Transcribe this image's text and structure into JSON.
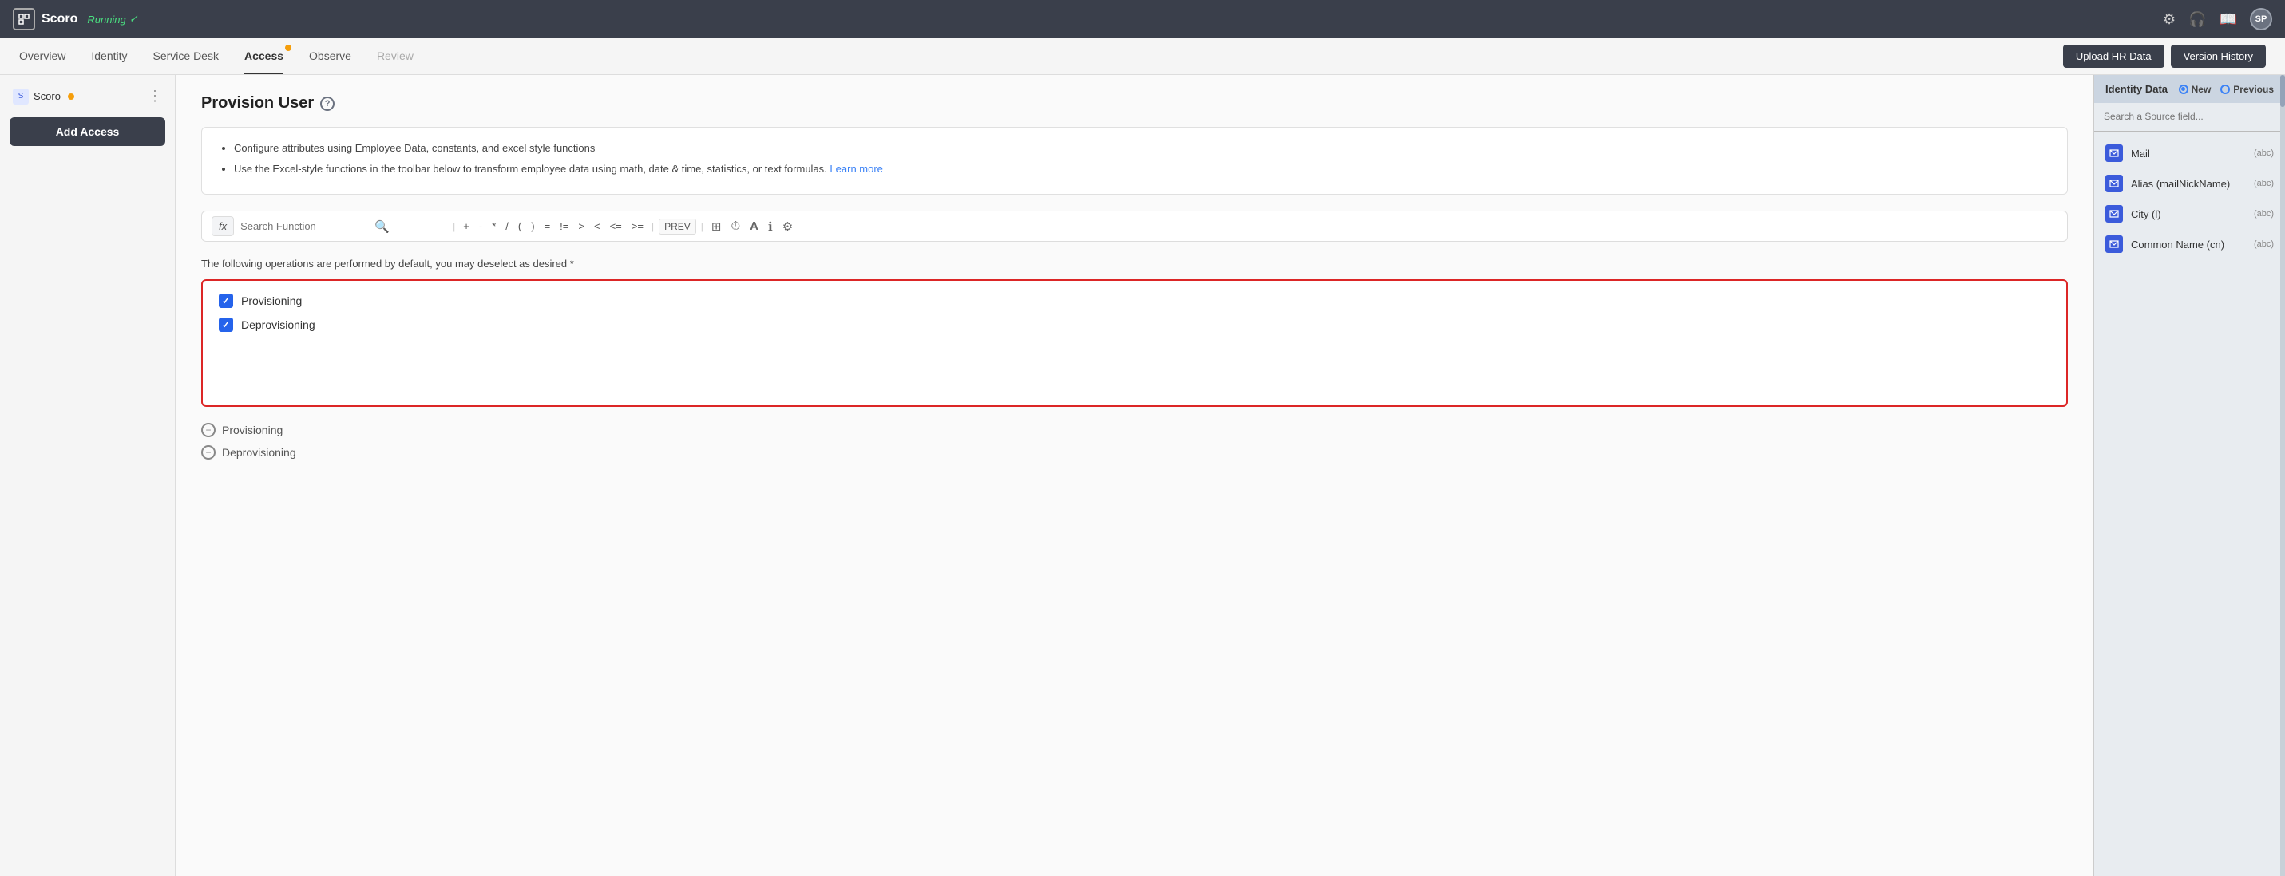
{
  "app": {
    "logo_text": "Scoro",
    "running_label": "Running",
    "check_icon": "✓"
  },
  "top_nav": {
    "settings_icon": "⚙",
    "headset_icon": "🎧",
    "book_icon": "📖",
    "avatar_initials": "SP",
    "upload_hr_data": "Upload HR Data",
    "version_history": "Version History"
  },
  "second_nav": {
    "tabs": [
      {
        "label": "Overview",
        "active": false,
        "muted": false,
        "badge": false
      },
      {
        "label": "Identity",
        "active": false,
        "muted": false,
        "badge": false
      },
      {
        "label": "Service Desk",
        "active": false,
        "muted": false,
        "badge": false
      },
      {
        "label": "Access",
        "active": true,
        "muted": false,
        "badge": true
      },
      {
        "label": "Observe",
        "active": false,
        "muted": false,
        "badge": false
      },
      {
        "label": "Review",
        "active": false,
        "muted": true,
        "badge": false
      }
    ]
  },
  "sidebar": {
    "brand_name": "Scoro",
    "brand_info_dot": true,
    "add_access_label": "Add Access"
  },
  "main": {
    "page_title": "Provision User",
    "help_icon": "?",
    "info_bullets": [
      "Configure attributes using Employee Data, constants, and excel style functions",
      "Use the Excel-style functions in the toolbar below to transform employee data using math, date & time, statistics, or text formulas."
    ],
    "learn_more_label": "Learn more",
    "toolbar": {
      "fx_label": "fx",
      "search_placeholder": "Search Function",
      "operators": [
        "+",
        "-",
        "*",
        "/",
        "(",
        ")",
        "=",
        "!=",
        ">",
        "<",
        "<=",
        ">="
      ],
      "prev_label": "PREV",
      "icons": [
        "⊞",
        "⏱",
        "A",
        "ℹ",
        "⚙"
      ]
    },
    "operations_note": "The following operations are performed by default, you may deselect as desired *",
    "checkboxes": [
      {
        "label": "Provisioning",
        "checked": true
      },
      {
        "label": "Deprovisioning",
        "checked": true
      }
    ],
    "collapsed_items": [
      {
        "label": "Provisioning"
      },
      {
        "label": "Deprovisioning"
      }
    ]
  },
  "right_panel": {
    "title": "Identity Data",
    "radio_options": [
      {
        "label": "New",
        "selected": true
      },
      {
        "label": "Previous",
        "selected": false
      }
    ],
    "search_placeholder": "Search a Source field...",
    "fields": [
      {
        "name": "Mail",
        "type": "(abc)"
      },
      {
        "name": "Alias (mailNickName)",
        "type": "(abc)"
      },
      {
        "name": "City (l)",
        "type": "(abc)"
      },
      {
        "name": "Common Name (cn)",
        "type": "(abc)"
      }
    ]
  }
}
